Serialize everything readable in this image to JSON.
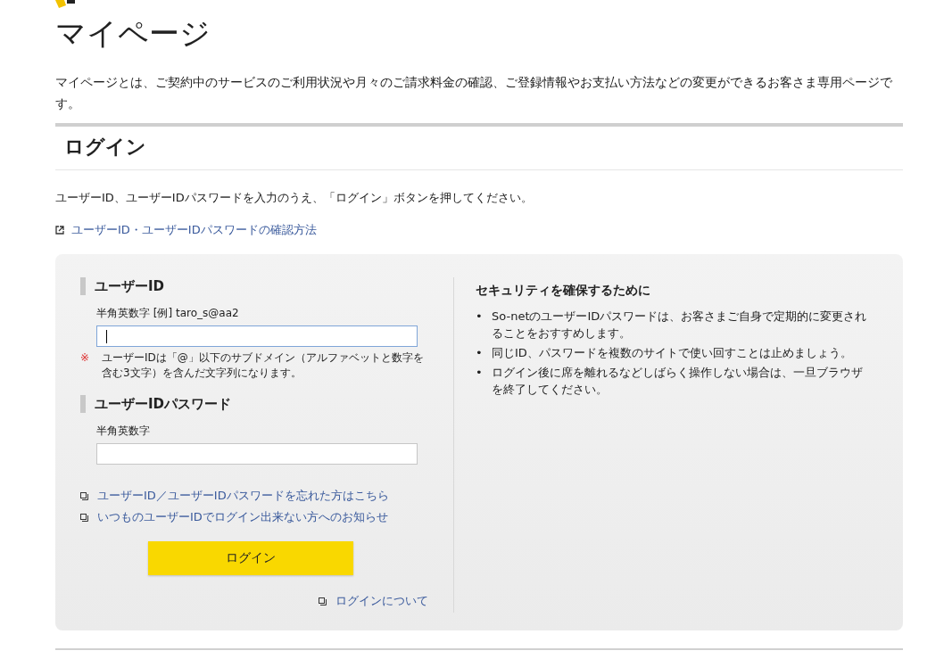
{
  "page": {
    "title": "マイページ",
    "description": "マイページとは、ご契約中のサービスのご利用状況や月々のご請求料金の確認、ご登録情報やお支払い方法などの変更ができるお客さま専用ページです。"
  },
  "login": {
    "heading": "ログイン",
    "instruction": "ユーザーID、ユーザーIDパスワードを入力のうえ、「ログイン」ボタンを押してください。",
    "help_link": "ユーザーID・ユーザーIDパスワードの確認方法",
    "fields": [
      {
        "label": "ユーザーID",
        "hint": "半角英数字 [例] taro_s@aa2",
        "focused": true,
        "note": "ユーザーIDは「@」以下のサブドメイン（アルファベットと数字を含む3文字）を含んだ文字列になります。",
        "note_mark": "※"
      },
      {
        "label": "ユーザーIDパスワード",
        "hint": "半角英数字",
        "focused": false
      }
    ],
    "links": [
      "ユーザーID／ユーザーIDパスワードを忘れた方はこちら",
      "いつものユーザーIDでログイン出来ない方へのお知らせ"
    ],
    "button": "ログイン",
    "about_link": "ログインについて",
    "security": {
      "heading": "セキュリティを確保するために",
      "bullet": "•",
      "items": [
        "So-netのユーザーIDパスワードは、お客さまご自身で定期的に変更されることをおすすめします。",
        "同じID、パスワードを複数のサイトで使い回すことは止めましょう。",
        "ログイン後に席を離れるなどしばらく操作しない場合は、一旦ブラウザを終了してください。"
      ]
    }
  }
}
